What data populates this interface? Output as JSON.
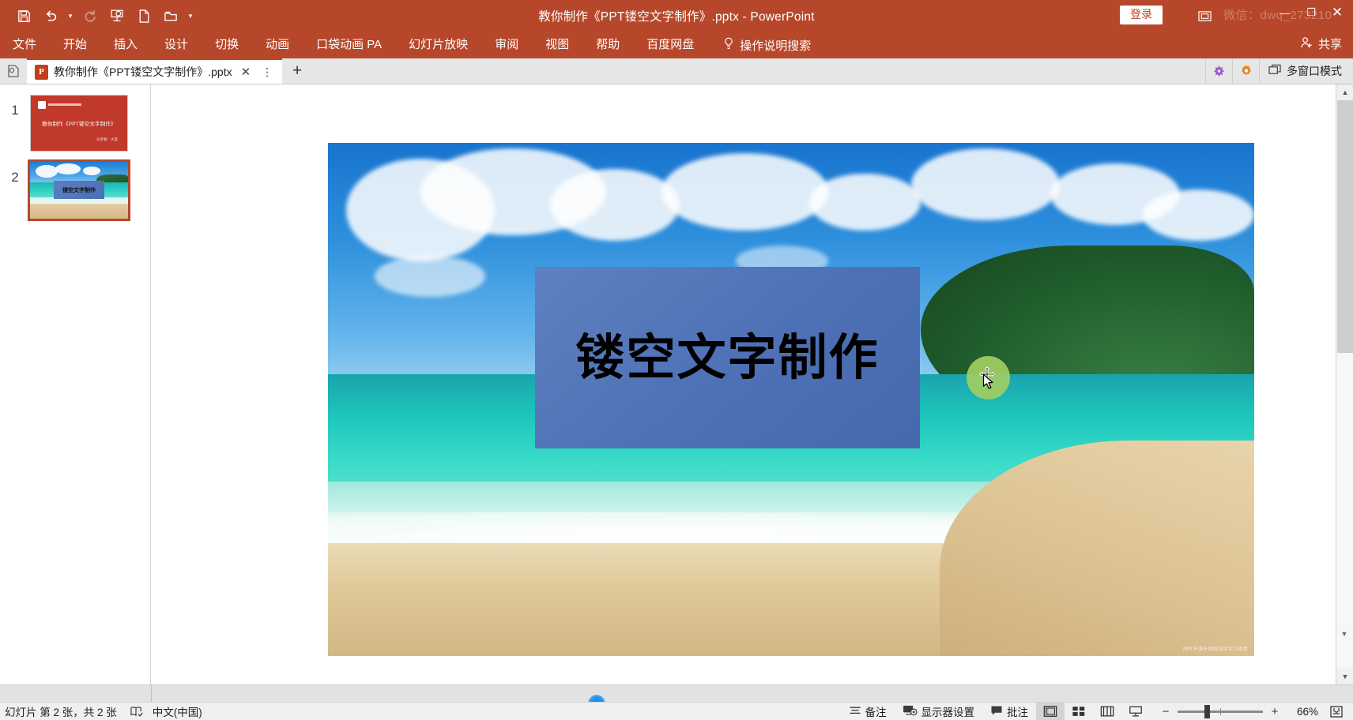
{
  "titlebar": {
    "document_title": "教你制作《PPT镂空文字制作》.pptx  -  PowerPoint",
    "signin_label": "登录",
    "watermark": "微信：dwq_273210",
    "quick_access": [
      {
        "name": "save-icon",
        "tooltip": "保存"
      },
      {
        "name": "undo-icon",
        "tooltip": "撤消"
      },
      {
        "name": "redo-icon",
        "tooltip": "恢复"
      },
      {
        "name": "start-presentation-icon",
        "tooltip": "从头开始"
      },
      {
        "name": "new-file-icon",
        "tooltip": "新建"
      },
      {
        "name": "open-file-icon",
        "tooltip": "打开"
      },
      {
        "name": "customize-qat-icon",
        "tooltip": "自定义快速访问工具栏"
      }
    ],
    "window_controls": {
      "minimize": "—",
      "maximize": "❐",
      "close": "✕"
    }
  },
  "menubar": {
    "items": [
      {
        "label": "文件"
      },
      {
        "label": "开始"
      },
      {
        "label": "插入"
      },
      {
        "label": "设计"
      },
      {
        "label": "切换"
      },
      {
        "label": "动画"
      },
      {
        "label": "口袋动画 PA"
      },
      {
        "label": "幻灯片放映"
      },
      {
        "label": "审阅"
      },
      {
        "label": "视图"
      },
      {
        "label": "帮助"
      },
      {
        "label": "百度网盘"
      }
    ],
    "tell_me": "操作说明搜索",
    "share_label": "共享"
  },
  "tabstrip": {
    "tab_label": "教你制作《PPT镂空文字制作》.pptx",
    "tab_app_badge": "P",
    "close_glyph": "✕",
    "more_glyph": "⋮",
    "new_tab_glyph": "+",
    "multi_window_label": "多窗口模式"
  },
  "thumbnails": [
    {
      "number": "1",
      "selected": false,
      "title": "教你制作《PPT镂空文字制作》",
      "subtitle": "分享者：大圣"
    },
    {
      "number": "2",
      "selected": true,
      "title": "镂空文字制作"
    }
  ],
  "slide": {
    "textbox_text": "镂空文字制作",
    "image_watermark": "图片来源于网络仅供学习使用",
    "accent_rect_color": "#4e70b5",
    "text_color": "#000000",
    "click_highlight_color": "#a0ce63"
  },
  "statusbar": {
    "slide_indicator": "幻灯片 第 2 张，共 2 张",
    "language": "中文(中国)",
    "accessibility_icon": "spellcheck-icon",
    "notes_label": "备注",
    "display_settings_label": "显示器设置",
    "comments_label": "批注",
    "views": [
      {
        "name": "normal-view",
        "active": true
      },
      {
        "name": "slide-sorter-view",
        "active": false
      },
      {
        "name": "reading-view",
        "active": false
      },
      {
        "name": "slideshow-view",
        "active": false
      }
    ],
    "zoom_out_glyph": "−",
    "zoom_in_glyph": "+",
    "zoom_level": "66%",
    "fit_to_window_name": "fit-slide-to-window-icon"
  }
}
